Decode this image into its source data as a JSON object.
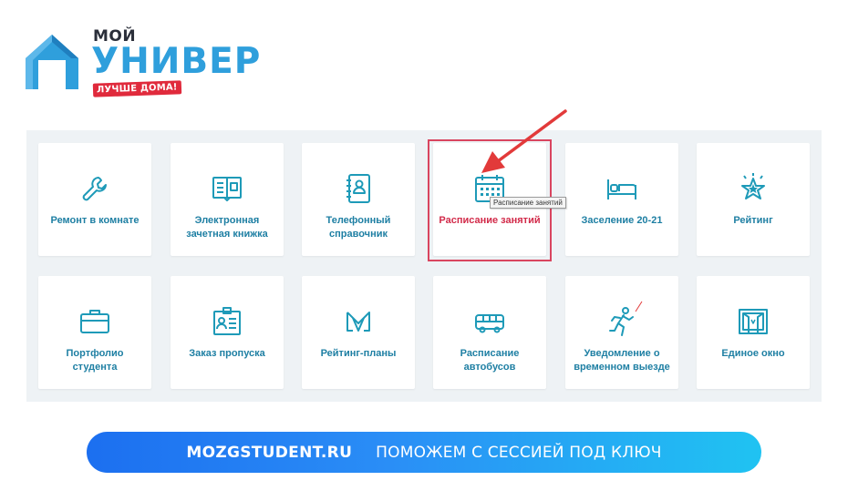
{
  "logo": {
    "small": "МОЙ",
    "big": "УНИВЕР",
    "badge": "ЛУЧШЕ ДОМА!"
  },
  "tiles": [
    {
      "label": "Ремонт в комнате",
      "icon": "wrench-icon"
    },
    {
      "label": "Электронная зачетная книжка",
      "icon": "record-book-icon"
    },
    {
      "label": "Телефонный справочник",
      "icon": "phone-book-icon"
    },
    {
      "label": "Расписание занятий",
      "icon": "calendar-icon",
      "active": true
    },
    {
      "label": "Заселение 20-21",
      "icon": "bed-icon"
    },
    {
      "label": "Рейтинг",
      "icon": "star-icon"
    },
    {
      "label": "Портфолио студента",
      "icon": "briefcase-icon"
    },
    {
      "label": "Заказ пропуска",
      "icon": "id-card-icon"
    },
    {
      "label": "Рейтинг-планы",
      "icon": "rating-plan-icon"
    },
    {
      "label": "Расписание автобусов",
      "icon": "bus-icon"
    },
    {
      "label": "Уведомление о временном выезде",
      "icon": "running-man-icon"
    },
    {
      "label": "Единое окно",
      "icon": "window-icon"
    }
  ],
  "tooltip": "Расписание занятий",
  "banner": {
    "site": "MOZGSTUDENT.RU",
    "text": "ПОМОЖЕМ С СЕССИЕЙ ПОД КЛЮЧ"
  },
  "colors": {
    "accent": "#2f9fdc",
    "tile_label": "#1e7fa3",
    "active_label": "#d22b4a",
    "highlight": "#d9455f",
    "panel_bg": "#eef2f5"
  }
}
